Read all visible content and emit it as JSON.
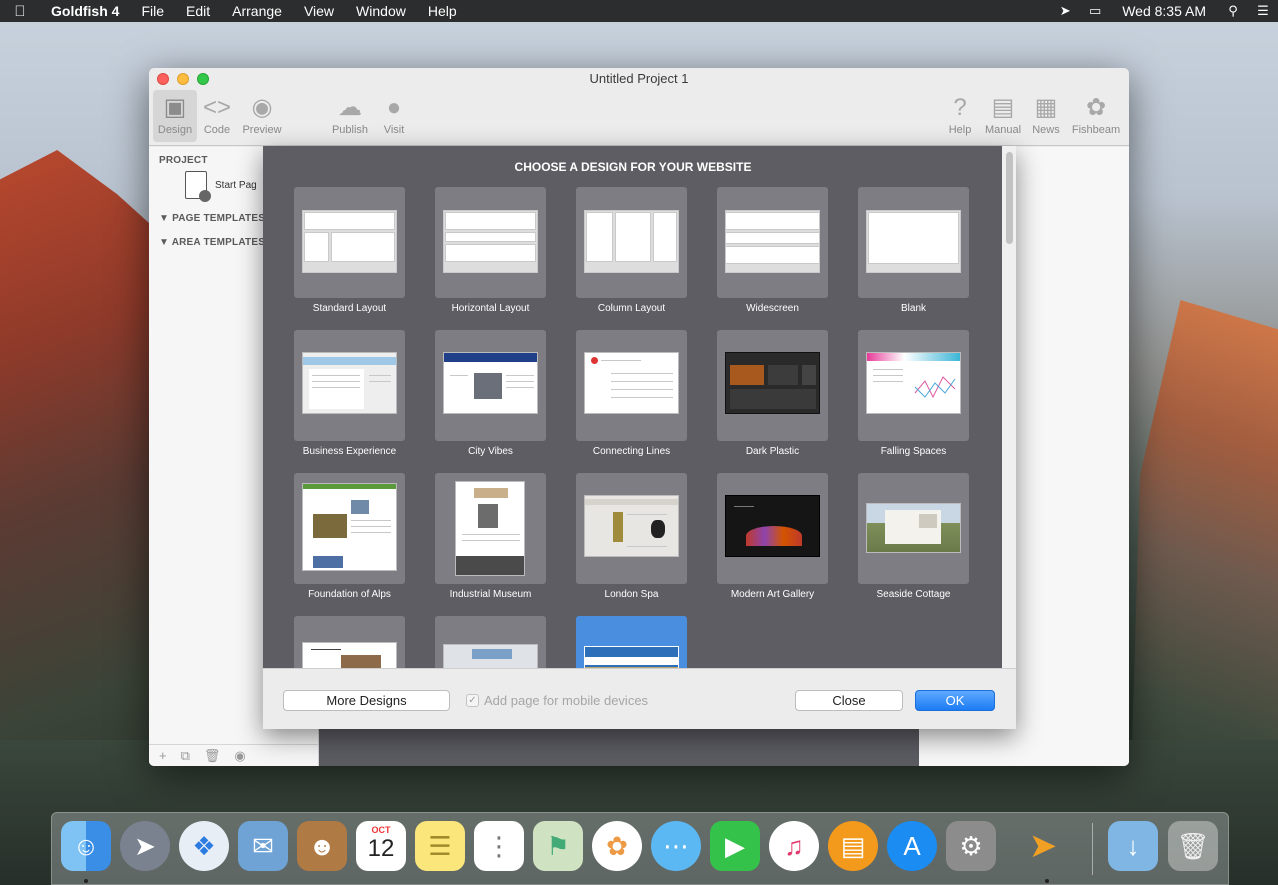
{
  "menubar": {
    "app_name": "Goldfish 4",
    "menus": [
      "File",
      "Edit",
      "Arrange",
      "View",
      "Window",
      "Help"
    ],
    "clock": "Wed 8:35 AM"
  },
  "window": {
    "title": "Untitled Project 1",
    "toolbar": {
      "design": "Design",
      "code": "Code",
      "preview": "Preview",
      "publish": "Publish",
      "visit": "Visit",
      "help": "Help",
      "manual": "Manual",
      "news": "News",
      "fishbeam": "Fishbeam"
    },
    "sidebar": {
      "project_heading": "PROJECT",
      "start_page": "Start Pag",
      "page_templates": "PAGE TEMPLATES",
      "area_templates": "AREA TEMPLATES"
    }
  },
  "dialog": {
    "title": "CHOOSE A DESIGN FOR YOUR WEBSITE",
    "designs": [
      {
        "name": "Standard Layout"
      },
      {
        "name": "Horizontal Layout"
      },
      {
        "name": "Column Layout"
      },
      {
        "name": "Widescreen"
      },
      {
        "name": "Blank"
      },
      {
        "name": "Business Experience"
      },
      {
        "name": "City Vibes"
      },
      {
        "name": "Connecting Lines"
      },
      {
        "name": "Dark Plastic"
      },
      {
        "name": "Falling Spaces"
      },
      {
        "name": "Foundation of Alps"
      },
      {
        "name": "Industrial Museum"
      },
      {
        "name": "London Spa"
      },
      {
        "name": "Modern Art Gallery"
      },
      {
        "name": "Seaside Cottage"
      }
    ],
    "more_designs": "More Designs",
    "mobile_checkbox": "Add page for mobile devices",
    "close": "Close",
    "ok": "OK"
  },
  "dock": {
    "items": [
      "finder-icon",
      "launchpad-icon",
      "safari-icon",
      "mail-icon",
      "contacts-icon",
      "calendar-icon",
      "notes-icon",
      "reminders-icon",
      "maps-icon",
      "photos-icon",
      "messages-icon",
      "facetime-icon",
      "itunes-icon",
      "ibooks-icon",
      "app-store-icon",
      "system-preferences-icon",
      "goldfish-icon",
      "downloads-folder-icon",
      "trash-icon"
    ],
    "calendar_month": "OCT",
    "calendar_day": "12"
  }
}
